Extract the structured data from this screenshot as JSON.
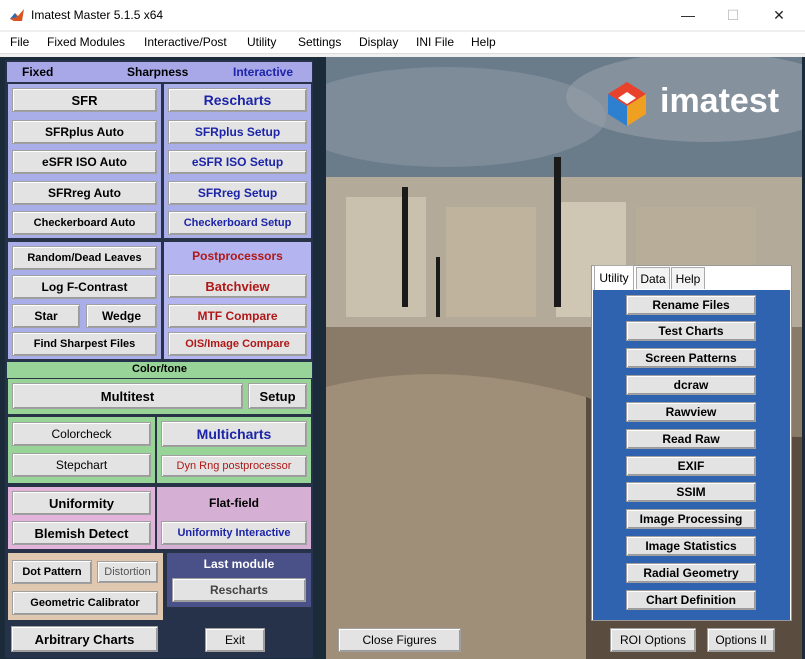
{
  "window": {
    "title": "Imatest Master 5.1.5 x64",
    "minimize": "—",
    "maximize": "☐",
    "close": "✕"
  },
  "menu": [
    "File",
    "Fixed Modules",
    "Interactive/Post",
    "Utility",
    "Settings",
    "Display",
    "INI File",
    "Help"
  ],
  "sharpness_header": {
    "fixed": "Fixed",
    "sharpness": "Sharpness",
    "interactive": "Interactive"
  },
  "sharpness_fixed": [
    "SFR",
    "SFRplus Auto",
    "eSFR ISO Auto",
    "SFRreg Auto",
    "Checkerboard Auto"
  ],
  "sharpness_interactive": [
    "Rescharts",
    "SFRplus Setup",
    "eSFR ISO Setup",
    "SFRreg Setup",
    "Checkerboard Setup"
  ],
  "misc": {
    "random_dead_leaves": "Random/Dead Leaves",
    "log_f_contrast": "Log F-Contrast",
    "star": "Star",
    "wedge": "Wedge",
    "find_sharpest": "Find Sharpest Files"
  },
  "postprocessors": {
    "header": "Postprocessors",
    "batchview": "Batchview",
    "mtf_compare": "MTF Compare",
    "ois_compare": "OIS/Image Compare"
  },
  "color": {
    "header": "Color/tone",
    "multitest": "Multitest",
    "setup": "Setup",
    "colorcheck": "Colorcheck",
    "stepchart": "Stepchart",
    "multicharts": "Multicharts",
    "dyn_rng": "Dyn Rng postprocessor"
  },
  "flat": {
    "uniformity": "Uniformity",
    "blemish": "Blemish Detect",
    "header": "Flat-field",
    "uniformity_interactive": "Uniformity Interactive"
  },
  "geometry": {
    "dot_pattern": "Dot Pattern",
    "distortion": "Distortion",
    "geometric_calibrator": "Geometric Calibrator"
  },
  "last_module": {
    "header": "Last module",
    "value": "Rescharts"
  },
  "bottom": {
    "arbitrary_charts": "Arbitrary Charts",
    "exit": "Exit",
    "close_figures": "Close Figures",
    "roi_options": "ROI Options",
    "options_ii": "Options II"
  },
  "logo": {
    "text": "imatest"
  },
  "utility_tabs": [
    "Utility",
    "Data",
    "Help"
  ],
  "utility_buttons": [
    "Rename Files",
    "Test Charts",
    "Screen Patterns",
    "dcraw",
    "Rawview",
    "Read Raw",
    "EXIF",
    "SSIM",
    "Image Processing",
    "Image Statistics",
    "Radial Geometry",
    "Chart Definition"
  ]
}
